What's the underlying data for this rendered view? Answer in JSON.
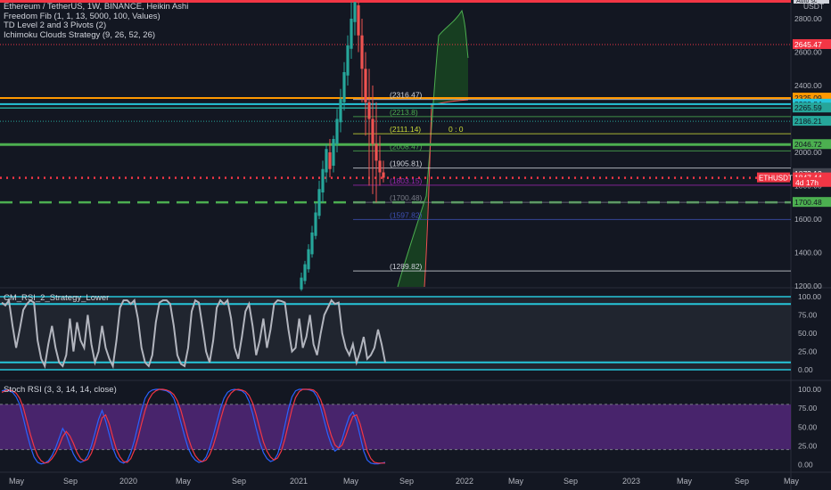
{
  "header": {
    "title": "Ethereum / TetherUS, 1W, BINANCE, Heikin Ashi",
    "indicators": [
      "Freedom Fib (1, 1, 13, 5000, 100, Values)",
      "TD Level 2 and 3 Pivots (2)",
      "Ichimoku Clouds Strategy (9, 26, 52, 26)"
    ],
    "currency": "USDT",
    "top_tag": "Auto sc"
  },
  "colors": {
    "background": "#131722",
    "axis_text": "#b2b5be",
    "red": "#f23645",
    "green": "#4caf50",
    "teal": "#26c6da",
    "orange": "#ff9800",
    "purple": "#5b2a86",
    "candle_up": "#26a69a",
    "candle_down": "#ef5350"
  },
  "chart_data": [
    {
      "pane": "price",
      "type": "candlestick",
      "y_ticks": [
        1200,
        1400,
        1600,
        1800,
        2000,
        2200,
        2400,
        2600,
        2800
      ],
      "y_tick_labels": [
        "1200.00",
        "1400.00",
        "1600.00",
        "1800.00",
        "2000.00",
        "2200.00",
        "2400.00",
        "2600.00",
        "2800.00"
      ],
      "ylim": [
        1180,
        2900
      ],
      "candles": [
        [
          1180,
          1250,
          1170,
          1280
        ],
        [
          1230,
          1330,
          1210,
          1350
        ],
        [
          1300,
          1420,
          1280,
          1450
        ],
        [
          1390,
          1520,
          1370,
          1560
        ],
        [
          1500,
          1640,
          1480,
          1700
        ],
        [
          1620,
          1780,
          1600,
          1830
        ],
        [
          1760,
          1900,
          1700,
          1950
        ],
        [
          1880,
          2020,
          1820,
          2050
        ],
        [
          2000,
          1900,
          1850,
          2080
        ],
        [
          1920,
          2080,
          1880,
          2100
        ],
        [
          2050,
          2200,
          2000,
          2260
        ],
        [
          2180,
          2320,
          2120,
          2380
        ],
        [
          2300,
          2480,
          2250,
          2540
        ],
        [
          2460,
          2640,
          2400,
          2700
        ],
        [
          2620,
          2800,
          2560,
          2900
        ],
        [
          2780,
          2900,
          2700,
          2900
        ],
        [
          2880,
          2700,
          2600,
          2900
        ],
        [
          2700,
          2500,
          2300,
          2800
        ],
        [
          2500,
          2300,
          2100,
          2600
        ],
        [
          2300,
          2200,
          1800,
          2500
        ],
        [
          2200,
          2050,
          1750,
          2400
        ],
        [
          2050,
          1950,
          1700,
          2300
        ],
        [
          1950,
          1880,
          1800,
          2100
        ],
        [
          1880,
          1848,
          1820,
          1950
        ]
      ],
      "price_labels": [
        {
          "text": "2645.47",
          "value": 2645.47,
          "color": "#f23645"
        },
        {
          "text": "2325.09",
          "value": 2325.09,
          "color": "#ff9800"
        },
        {
          "text": "2288.84",
          "value": 2288.84,
          "color": "#26c6da"
        },
        {
          "text": "2265.59",
          "value": 2265.59,
          "color": "#26a69a"
        },
        {
          "text": "2186.21",
          "value": 2186.21,
          "color": "#26a69a"
        },
        {
          "text": "2046.72",
          "value": 2046.72,
          "color": "#4caf50"
        },
        {
          "text": "1873.12",
          "value": 1873.12,
          "color": "#787b86"
        },
        {
          "text": "1847.44",
          "value": 1847.44,
          "color": "#f23645"
        },
        {
          "text": "4d 17h",
          "value": 1820,
          "color": "#f23645"
        },
        {
          "text": "1700.48",
          "value": 1700.48,
          "color": "#4caf50"
        }
      ],
      "symbol_tag": "ETHUSDT",
      "fib_levels": [
        {
          "text": "(2316.47)",
          "value": 2316.47,
          "color": "#d1d4dc"
        },
        {
          "text": "(2213.8)",
          "value": 2213.8,
          "color": "#4caf50"
        },
        {
          "text": "(2111.14)",
          "value": 2111.14,
          "color": "#cddc39"
        },
        {
          "text": "0 : 0",
          "value": 2111.14,
          "color": "#cddc39"
        },
        {
          "text": "(2008.47)",
          "value": 2008.47,
          "color": "#4caf50"
        },
        {
          "text": "(1905.81)",
          "value": 1905.81,
          "color": "#d1d4dc"
        },
        {
          "text": "(1803.15)",
          "value": 1803.15,
          "color": "#9c27b0"
        },
        {
          "text": "(1700.48)",
          "value": 1700.48,
          "color": "#787b86"
        },
        {
          "text": "(1597.82)",
          "value": 1597.82,
          "color": "#3f51b5"
        },
        {
          "text": "(1289.82)",
          "value": 1289.82,
          "color": "#d1d4dc"
        }
      ]
    },
    {
      "pane": "cm_rsi",
      "type": "line",
      "title": "CM_RSI_2_Strategy_Lower",
      "y_ticks": [
        0,
        25,
        50,
        75,
        100
      ],
      "y_tick_labels": [
        "0.00",
        "25.00",
        "50.00",
        "75.00",
        "100.00"
      ],
      "ylim": [
        -3,
        102
      ],
      "values": [
        92,
        88,
        95,
        60,
        30,
        55,
        82,
        90,
        95,
        92,
        40,
        15,
        5,
        35,
        60,
        30,
        10,
        5,
        20,
        70,
        25,
        65,
        40,
        30,
        75,
        35,
        10,
        25,
        60,
        30,
        15,
        5,
        40,
        85,
        95,
        95,
        90,
        95,
        70,
        30,
        10,
        5,
        20,
        65,
        92,
        95,
        95,
        90,
        60,
        20,
        8,
        5,
        30,
        80,
        95,
        92,
        60,
        25,
        10,
        40,
        85,
        95,
        90,
        95,
        70,
        30,
        15,
        45,
        80,
        90,
        60,
        20,
        40,
        70,
        30,
        55,
        90,
        95,
        94,
        92,
        55,
        25,
        30,
        70,
        30,
        45,
        75,
        35,
        20,
        50,
        75,
        85,
        95,
        90,
        92,
        50,
        30,
        20,
        35,
        10,
        25,
        45,
        15,
        20,
        30,
        55,
        35,
        10
      ]
    },
    {
      "pane": "stoch_rsi",
      "type": "line",
      "title": "Stoch RSI (3, 3, 14, 14, close)",
      "y_ticks": [
        0,
        25,
        50,
        75,
        100
      ],
      "y_tick_labels": [
        "0.00",
        "25.00",
        "50.00",
        "75.00",
        "100.00"
      ],
      "ylim": [
        -3,
        102
      ],
      "band": [
        20,
        80
      ],
      "series": [
        {
          "color": "#2962ff",
          "values": [
            98,
            99,
            98,
            96,
            90,
            80,
            62,
            42,
            24,
            10,
            3,
            1,
            2,
            5,
            12,
            22,
            35,
            48,
            40,
            26,
            14,
            6,
            3,
            5,
            12,
            25,
            42,
            60,
            72,
            58,
            40,
            22,
            10,
            4,
            2,
            5,
            16,
            32,
            52,
            72,
            88,
            96,
            99,
            100,
            100,
            99,
            98,
            95,
            88,
            74,
            56,
            38,
            22,
            12,
            6,
            3,
            4,
            10,
            22,
            38,
            56,
            74,
            88,
            96,
            99,
            100,
            99,
            98,
            94,
            84,
            68,
            48,
            30,
            16,
            8,
            4,
            6,
            14,
            30,
            52,
            74,
            90,
            98,
            100,
            100,
            100,
            99,
            97,
            90,
            76,
            58,
            40,
            26,
            18,
            22,
            34,
            50,
            64,
            70,
            58,
            38,
            18,
            6,
            2,
            1,
            1,
            2,
            3
          ]
        },
        {
          "color": "#f23645",
          "values": [
            96,
            98,
            99,
            98,
            95,
            88,
            76,
            58,
            40,
            24,
            12,
            5,
            2,
            3,
            8,
            15,
            25,
            37,
            44,
            38,
            28,
            16,
            8,
            5,
            7,
            15,
            29,
            46,
            62,
            66,
            54,
            36,
            20,
            10,
            4,
            3,
            8,
            19,
            35,
            54,
            72,
            86,
            94,
            98,
            100,
            100,
            99,
            97,
            93,
            85,
            72,
            54,
            36,
            22,
            12,
            6,
            4,
            6,
            13,
            25,
            41,
            59,
            76,
            88,
            95,
            99,
            100,
            99,
            97,
            92,
            82,
            66,
            48,
            30,
            18,
            10,
            6,
            9,
            18,
            34,
            54,
            74,
            89,
            97,
            100,
            100,
            100,
            99,
            95,
            86,
            72,
            54,
            38,
            26,
            22,
            26,
            38,
            52,
            64,
            66,
            54,
            36,
            18,
            8,
            3,
            2,
            2,
            2
          ]
        }
      ]
    },
    {
      "pane": "time_axis",
      "type": "axis",
      "x_labels": [
        "May",
        "Sep",
        "2020",
        "May",
        "Sep",
        "2021",
        "May",
        "Sep",
        "2022",
        "May",
        "Sep",
        "2023",
        "May",
        "Sep",
        "May"
      ]
    }
  ]
}
